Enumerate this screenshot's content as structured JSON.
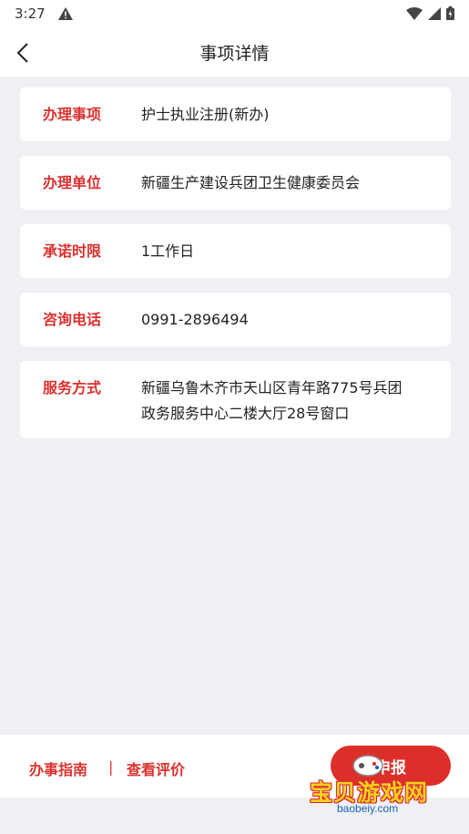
{
  "status": {
    "time": "3:27"
  },
  "header": {
    "title": "事项详情"
  },
  "details": [
    {
      "label": "办理事项",
      "value": "护士执业注册(新办)"
    },
    {
      "label": "办理单位",
      "value": "新疆生产建设兵团卫生健康委员会"
    },
    {
      "label": "承诺时限",
      "value": "1工作日"
    },
    {
      "label": "咨询电话",
      "value": "0991-2896494"
    },
    {
      "label": "服务方式",
      "value_line1": "新疆乌鲁木齐市天山区青年路775号兵团",
      "value_line2": "政务服务中心二楼大厅28号窗口"
    }
  ],
  "footer": {
    "guide_label": "办事指南",
    "separator": "|",
    "review_label": "查看评价",
    "apply_label": "申报"
  },
  "watermark": {
    "text": "宝贝游戏网",
    "url": "baobeiy.com"
  },
  "colors": {
    "accent": "#d9322e",
    "background": "#eef0f3"
  }
}
